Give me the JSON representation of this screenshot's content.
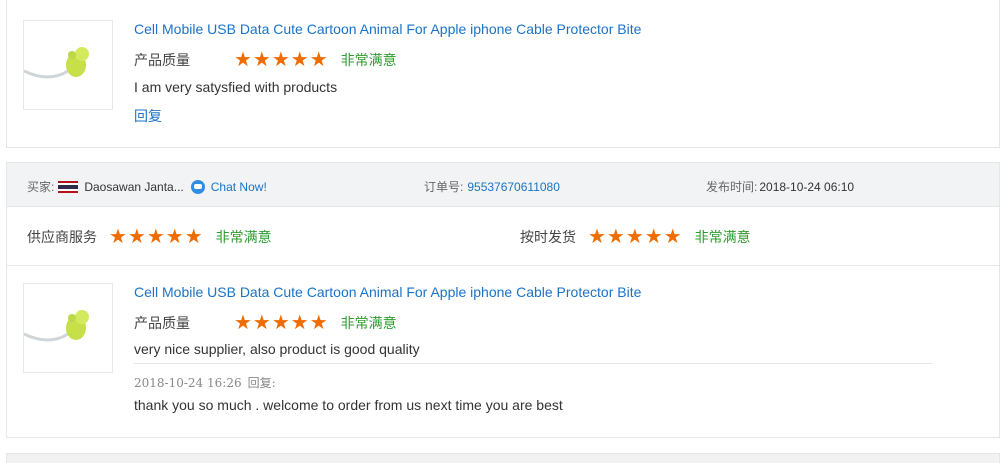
{
  "colors": {
    "accent_link": "#1a73c7",
    "star": "#ef6c00",
    "satisfied": "#2e9c2e",
    "header_bg": "#f2f3f5"
  },
  "review1": {
    "product_title": "Cell Mobile USB Data Cute Cartoon Animal For Apple iphone Cable Protector Bite",
    "quality_label": "产品质量",
    "quality_rating": 5,
    "quality_text": "非常满意",
    "comment": "I am very satysfied with products",
    "reply_label": "回复"
  },
  "review2": {
    "buyer_label": "买家:",
    "buyer_flag": "thailand-flag",
    "buyer_name": "Daosawan Janta...",
    "chat_label": "Chat Now!",
    "order_label": "订单号:",
    "order_number": "95537670611080",
    "post_time_label": "发布时间:",
    "post_time": "2018-10-24 06:10",
    "supplier_service_label": "供应商服务",
    "supplier_service_rating": 5,
    "supplier_service_text": "非常满意",
    "on_time_label": "按时发货",
    "on_time_rating": 5,
    "on_time_text": "非常满意",
    "product_title": "Cell Mobile USB Data Cute Cartoon Animal For Apple iphone Cable Protector Bite",
    "quality_label": "产品质量",
    "quality_rating": 5,
    "quality_text": "非常满意",
    "comment": "very nice supplier, also product is good quality",
    "reply_time": "2018-10-24 16:26",
    "reply_time_label": "回复:",
    "reply_text": "thank you so much . welcome to order from us next time you are best"
  }
}
